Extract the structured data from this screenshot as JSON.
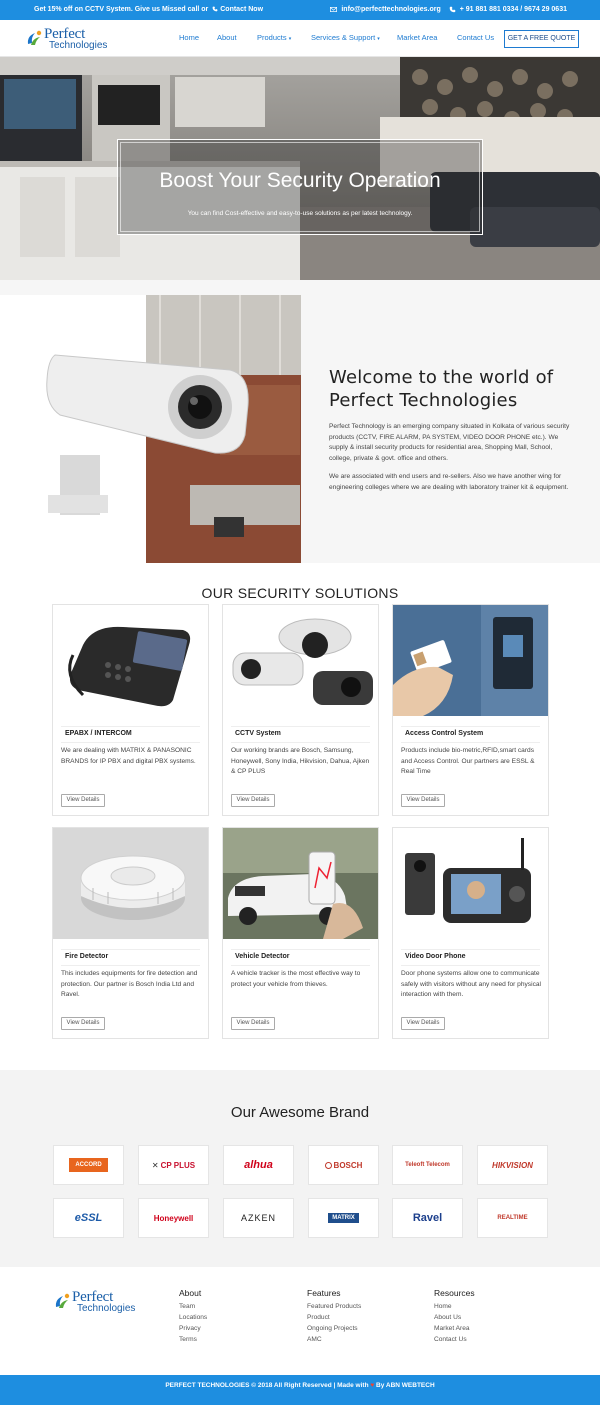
{
  "topbar": {
    "promo_text": "Get 15% off on CCTV System. Give us Missed call or",
    "promo_link": "Contact Now",
    "email": "info@perfecttechnologies.org",
    "phone": "+ 91 881 881 0334 / 9674 29 0631"
  },
  "logo": {
    "line1": "Perfect",
    "line2": "Technologies"
  },
  "nav": {
    "items": [
      "Home",
      "About",
      "Products",
      "Services & Support",
      "Market Area",
      "Contact Us"
    ],
    "quote_button": "GET A FREE QUOTE"
  },
  "hero": {
    "title": "Boost Your Security Operation",
    "subtitle": "You can find Cost-effective and easy-to-use solutions as per latest technology."
  },
  "welcome": {
    "title": "Welcome to the world of Perfect Technologies",
    "p1": "Perfect Technology is an emerging company situated in Kolkata of various security products (CCTV, FIRE ALARM, PA SYSTEM, VIDEO DOOR PHONE etc.). We supply & install security products for residential area, Shopping Mall, School, college, private & govt. office and others.",
    "p2": "We are associated with end users and re-sellers. Also we have another wing for engineering colleges where we are dealing with laboratory trainer kit & equipment."
  },
  "solutions": {
    "title": "OUR SECURITY SOLUTIONS",
    "button_label": "View Details",
    "cards": [
      {
        "title": "EPABX / INTERCOM",
        "desc": "We are dealing with MATRIX & PANASONIC BRANDS for IP PBX and digital PBX systems.",
        "icon": "ip-phone-icon"
      },
      {
        "title": "CCTV System",
        "desc": "Our working brands are Bosch, Samsung, Honeywell, Sony India, Hikvision, Dahua, Ajken & CP PLUS",
        "icon": "cctv-camera-icon"
      },
      {
        "title": "Access Control System",
        "desc": "Products include bio-metric,RFID,smart cards and Access Control. Our partners are ESSL & Real Time",
        "icon": "access-card-icon"
      },
      {
        "title": "Fire Detector",
        "desc": "This includes equipments for fire detection and protection. Our partner is Bosch India Ltd and Ravel.",
        "icon": "smoke-detector-icon"
      },
      {
        "title": "Vehicle Detector",
        "desc": "A vehicle tracker is the most effective way to protect your vehicle from thieves.",
        "icon": "vehicle-tracker-icon"
      },
      {
        "title": "Video Door Phone",
        "desc": "Door phone systems allow one to communicate safely with visitors without any need for physical interaction with them.",
        "icon": "video-door-phone-icon"
      }
    ]
  },
  "brands": {
    "title": "Our Awesome Brand",
    "items": [
      {
        "name": "ACCORD",
        "color": "#e8651e"
      },
      {
        "name": "CP PLUS",
        "color": "#c8102e"
      },
      {
        "name": "alhua",
        "color": "#d0021b"
      },
      {
        "name": "BOSCH",
        "color": "#c0392b"
      },
      {
        "name": "Teleoft Telecom",
        "color": "#c0392b"
      },
      {
        "name": "HIKVISION",
        "color": "#c0392b"
      },
      {
        "name": "eSSL",
        "color": "#1c5aa8"
      },
      {
        "name": "Honeywell",
        "color": "#d0021b"
      },
      {
        "name": "AZKEN",
        "color": "#222222"
      },
      {
        "name": "MATRIX",
        "color": "#1f4e8c"
      },
      {
        "name": "Ravel",
        "color": "#1c3f8c"
      },
      {
        "name": "REALTIME",
        "color": "#c0392b"
      }
    ]
  },
  "footer": {
    "columns": [
      {
        "heading": "About",
        "links": [
          "Team",
          "Locations",
          "Privacy",
          "Terms"
        ]
      },
      {
        "heading": "Features",
        "links": [
          "Featured Products",
          "Product",
          "Ongoing Projects",
          "AMC"
        ]
      },
      {
        "heading": "Resources",
        "links": [
          "Home",
          "About Us",
          "Market Area",
          "Contact Us"
        ]
      }
    ],
    "copyright": "PERFECT TECHNOLOGIES © 2018 All Right Reserved | Made with",
    "credit": "By ABN WEBTECH"
  },
  "colors": {
    "accent": "#1e8ee0",
    "link": "#1e7bd1",
    "logo": "#1b5fa8"
  }
}
